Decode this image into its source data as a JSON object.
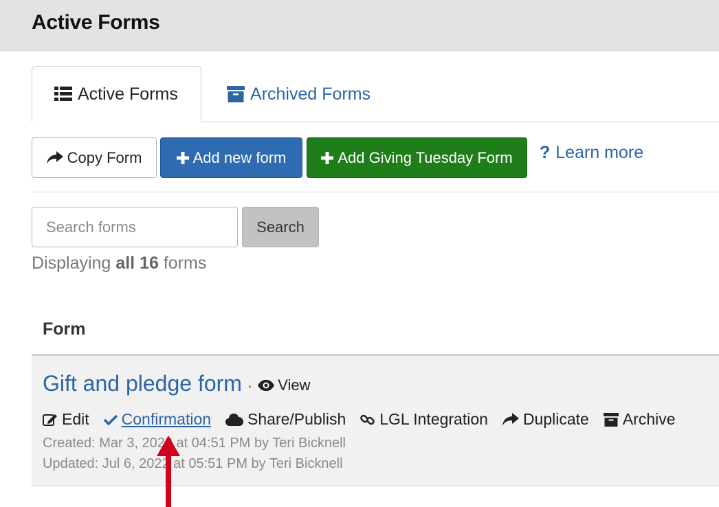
{
  "page": {
    "title": "Active Forms"
  },
  "tabs": [
    {
      "label": "Active Forms",
      "icon": "list-icon",
      "active": true
    },
    {
      "label": "Archived Forms",
      "icon": "archive-box-icon",
      "active": false
    }
  ],
  "toolbar": {
    "copy_label": "Copy Form",
    "add_label": "Add new form",
    "giving_label": "Add Giving Tuesday Form",
    "learn_label": "Learn more",
    "learn_icon": "?"
  },
  "search": {
    "placeholder": "Search forms",
    "value": "",
    "button_label": "Search"
  },
  "summary": {
    "prefix": "Displaying",
    "count": "all 16",
    "suffix": "forms"
  },
  "table": {
    "column_header": "Form",
    "rows": [
      {
        "title": "Gift and pledge form",
        "separator": "·",
        "view_label": "View",
        "actions": {
          "edit": "Edit",
          "confirmation": "Confirmation",
          "share": "Share/Publish",
          "lgl": "LGL Integration",
          "duplicate": "Duplicate",
          "archive": "Archive"
        },
        "created": "Created: Mar 3, 2022 at 04:51 PM by Teri Bicknell",
        "updated": "Updated: Jul 6, 2022 at 05:51 PM by Teri Bicknell"
      }
    ]
  },
  "colors": {
    "link_blue": "#2b65a6",
    "primary_button": "#2e6bb0",
    "success_button": "#1f7d1a",
    "annotation_arrow": "#d0021b"
  }
}
